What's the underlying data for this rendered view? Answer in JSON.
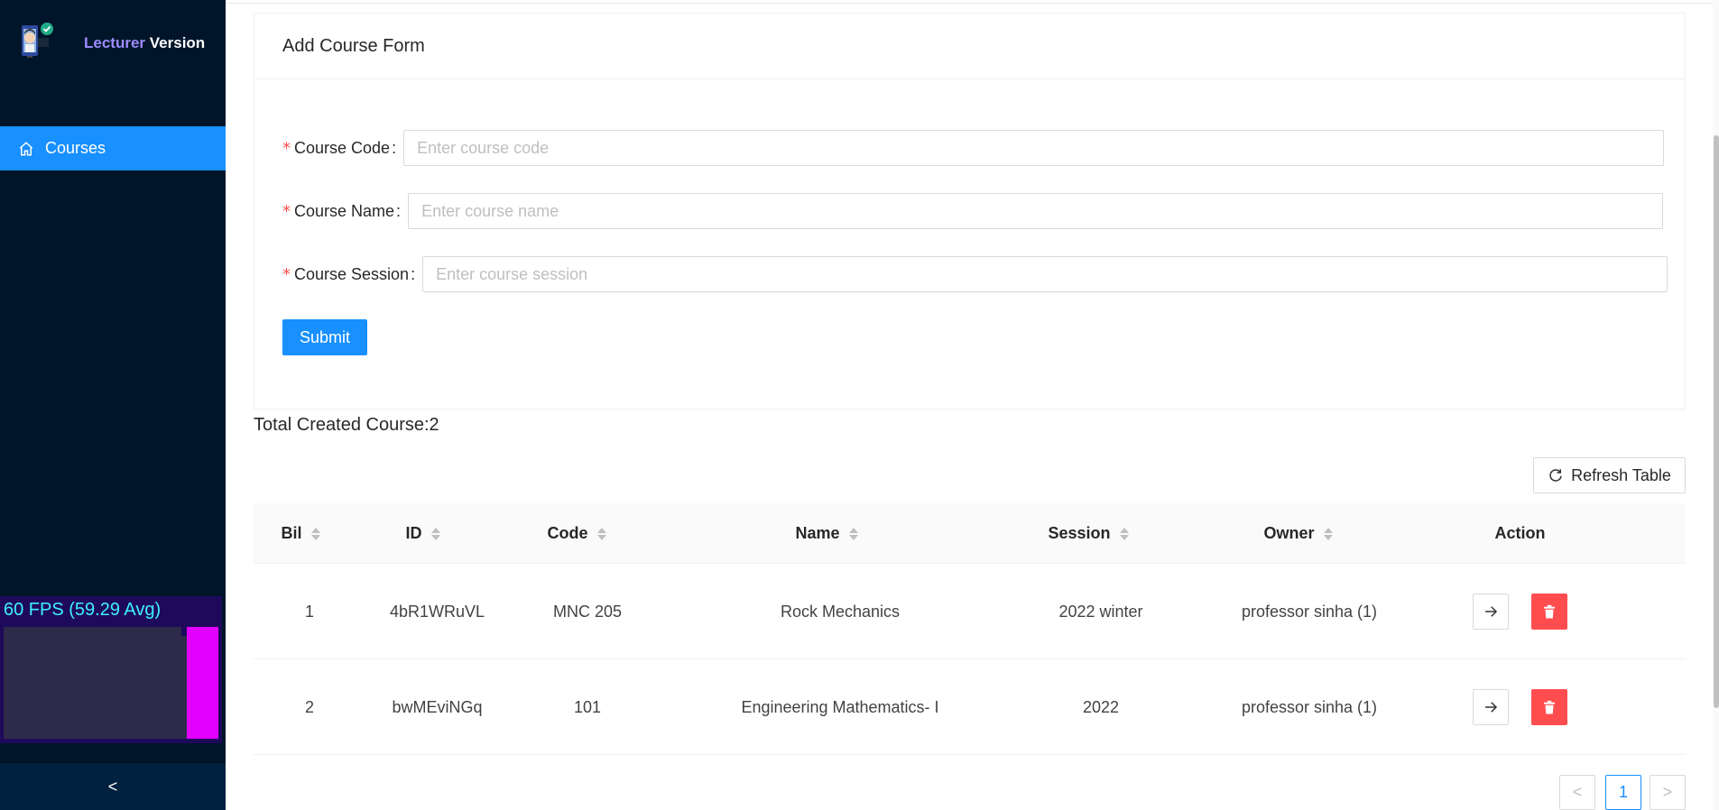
{
  "sidebar": {
    "brand_accent": "Lecturer",
    "brand_rest": "Version",
    "logo_icon": "lecturer-phone-check-logo",
    "menu_items": [
      {
        "label": "Courses",
        "icon": "home-icon",
        "active": true
      }
    ],
    "collapse_label": "<",
    "fps_text": "60 FPS (59.29 Avg)"
  },
  "form": {
    "title": "Add Course Form",
    "fields": {
      "course_code": {
        "label": "Course Code",
        "placeholder": "Enter course code",
        "value": ""
      },
      "course_name": {
        "label": "Course Name",
        "placeholder": "Enter course name",
        "value": ""
      },
      "course_session": {
        "label": "Course Session",
        "placeholder": "Enter course session",
        "value": ""
      }
    },
    "submit_label": "Submit"
  },
  "summary": {
    "total_text": "Total Created Course:2"
  },
  "toolbar": {
    "refresh_label": "Refresh Table"
  },
  "table": {
    "columns": [
      "Bil",
      "ID",
      "Code",
      "Name",
      "Session",
      "Owner",
      "Action"
    ],
    "rows": [
      {
        "bil": "1",
        "id": "4bR1WRuVL",
        "code": "MNC 205",
        "name": "Rock Mechanics",
        "session": "2022 winter",
        "owner": "professor sinha (1)"
      },
      {
        "bil": "2",
        "id": "bwMEviNGq",
        "code": "101",
        "name": "Engineering Mathematics- I",
        "session": "2022",
        "owner": "professor sinha (1)"
      }
    ]
  },
  "pagination": {
    "prev": "<",
    "current": "1",
    "next": ">"
  },
  "colors": {
    "sidebar_bg": "#001529",
    "primary": "#1890ff",
    "danger": "#ff4d4f",
    "brand_accent": "#9d8cff"
  }
}
